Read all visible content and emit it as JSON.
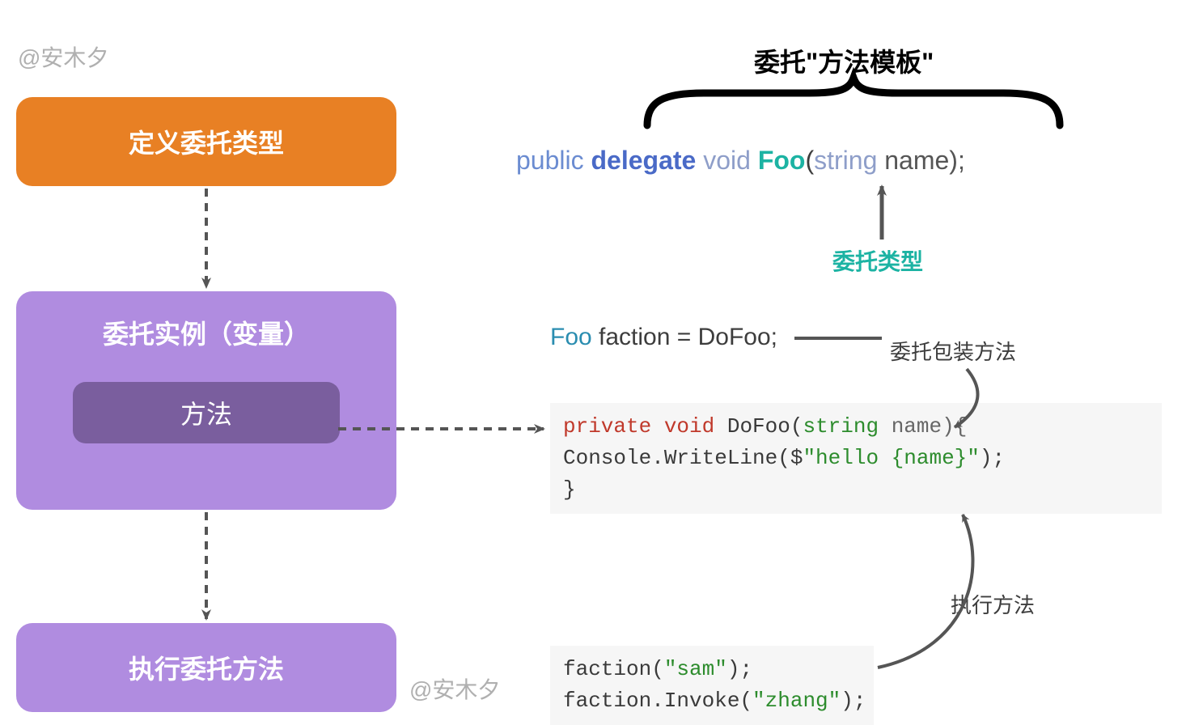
{
  "watermarks": {
    "top": "@安木夕",
    "bottom": "@安木夕"
  },
  "boxes": {
    "define": "定义委托类型",
    "instance": "委托实例（变量）",
    "method": "方法",
    "execute": "执行委托方法"
  },
  "annotations": {
    "template_title": "委托\"方法模板\"",
    "type_label": "委托类型",
    "wrap_label": "委托包装方法",
    "exec_label": "执行方法"
  },
  "delegate_decl": {
    "pub": "public",
    "del": "delegate",
    "void": "void",
    "foo": "Foo",
    "open": "(",
    "str": "string",
    "name": " name);"
  },
  "foo_line": {
    "foo": "Foo",
    "rest": " faction = DoFoo;"
  },
  "code_dofoo": {
    "priv": "private",
    "void": "void",
    "fn_open": " DoFoo(",
    "str": "string",
    "name_close": " name){",
    "console": "    Console.WriteLine($",
    "lit": "\"hello {name}\"",
    "close_paren": ");",
    "brace": "}"
  },
  "code_invoke": {
    "line1a": "faction(",
    "lit1": "\"sam\"",
    "line1b": ");",
    "line2a": "faction.Invoke(",
    "lit2": "\"zhang\"",
    "line2b": ");"
  }
}
